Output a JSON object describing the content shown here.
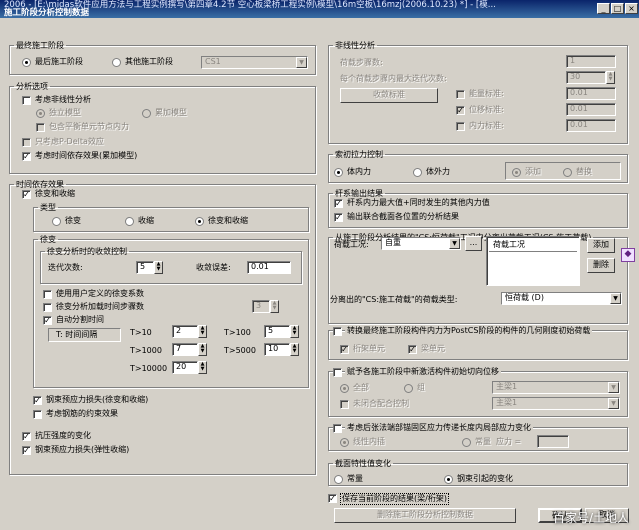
{
  "window": {
    "title": "2006 - [E:\\midas软件应用方法与工程实例撰写\\第四章4.2节 空心板梁桥工程实例\\模型\\16m空板\\16mzj(2006.10.23) *] - [模...",
    "dialog_title": "施工阶段分析控制数据",
    "min": "_",
    "max": "□",
    "close": "×"
  },
  "final": {
    "title": "最终施工阶段",
    "opt1": "最后施工阶段",
    "opt2": "其他施工阶段",
    "stage": "CS1"
  },
  "analysis": {
    "title": "分析选项",
    "nonlinear": "考虑非线性分析",
    "independent": "独立模型",
    "cumulative": "累加模型",
    "equilibrium": "包含平衡单元节点内力",
    "pdelta": "只考虑P-Delta效应",
    "timedep": "考虑时间依存效果(累加模型)"
  },
  "time": {
    "title": "时间依存效果",
    "creep_shrink": "徐变和收缩",
    "type_label": "类型",
    "creep": "徐变",
    "shrink": "收缩",
    "both": "徐变和收缩",
    "creep_title": "徐变",
    "conv_title": "徐变分析时的收敛控制",
    "iter_label": "迭代次数:",
    "iter": "5",
    "tol_label": "收敛误差:",
    "tol": "0.01",
    "user_coeff": "使用用户定义的徐变系数",
    "step_creep": "徐变分析加载时间步骤数",
    "step_val": "3",
    "auto_split": "自动分割时间",
    "t_interval": "T: 时间间隔",
    "t1": "T>10",
    "v1": "2",
    "t2": "T>100",
    "v2": "5",
    "t3": "T>1000",
    "v3": "7",
    "t4": "T>5000",
    "v4": "10",
    "t5": "T>10000",
    "v5": "20",
    "tendon_loss": "钢束预应力损失(徐变和收缩)",
    "rebar": "考虑钢筋的约束效果",
    "compress": "抗压强度的变化",
    "tendon_elastic": "钢束预应力损失(弹性收缩)"
  },
  "nonlin": {
    "title": "非线性分析",
    "load_steps_label": "荷载步骤数:",
    "load_steps": "1",
    "max_iter_label": "每个荷载步骤内最大迭代次数:",
    "max_iter": "30",
    "conv_btn": "收敛标准",
    "force": "能量标准:",
    "force_val": "0.01",
    "disp": "位移标准:",
    "disp_val": "0.01",
    "inner": "内力标准:",
    "inner_val": "0.01"
  },
  "cable": {
    "title": "索初拉力控制",
    "body": "体内力",
    "ext": "体外力",
    "add": "添加",
    "replace": "替换"
  },
  "truss": {
    "title": "杆系输出结果",
    "opt1": "杆系内力最大值+同时发生的其他内力值",
    "opt2": "输出联合截面各位置的分析结果"
  },
  "sep": {
    "title": "从施工阶段分析结果的\"CS:恒荷载\"工况中分离出荷载工况(CS:施工荷载)",
    "case_label": "荷载工况:",
    "case_val": "自重",
    "dots": "...",
    "list_header": "荷载工况",
    "add": "添加",
    "del": "删除",
    "sep_type_label": "分离出的\"CS:施工荷载\"的荷载类型:",
    "sep_type": "恒荷载 (D)"
  },
  "convert": {
    "title": "转换最终施工阶段构件内力为PostCS阶段的构件的几何刚度初始荷载",
    "beam": "桁架单元",
    "truss": "梁单元"
  },
  "init": {
    "title": "赋予各施工阶段中新激活构件初始切向位移",
    "all": "全部",
    "group": "组",
    "group_val": "主梁1",
    "unassigned": "未闭合配合控制",
    "unassigned_val": "主梁1"
  },
  "prestress": {
    "title": "考虑后张法端部锚固区应力传递长度内局部应力变化",
    "lin": "线性内插",
    "const": "常量",
    "stress": "应力 ="
  },
  "section": {
    "title": "截面特性值变化",
    "const": "常量",
    "tendon": "钢束引起的变化"
  },
  "save": {
    "label": "保存当前阶段的结果(梁/桁架)",
    "del_btn": "删除施工阶段分析控制数据"
  },
  "buttons": {
    "ok": "确认",
    "cancel": "取消"
  },
  "watermark": "百家号/土地人"
}
